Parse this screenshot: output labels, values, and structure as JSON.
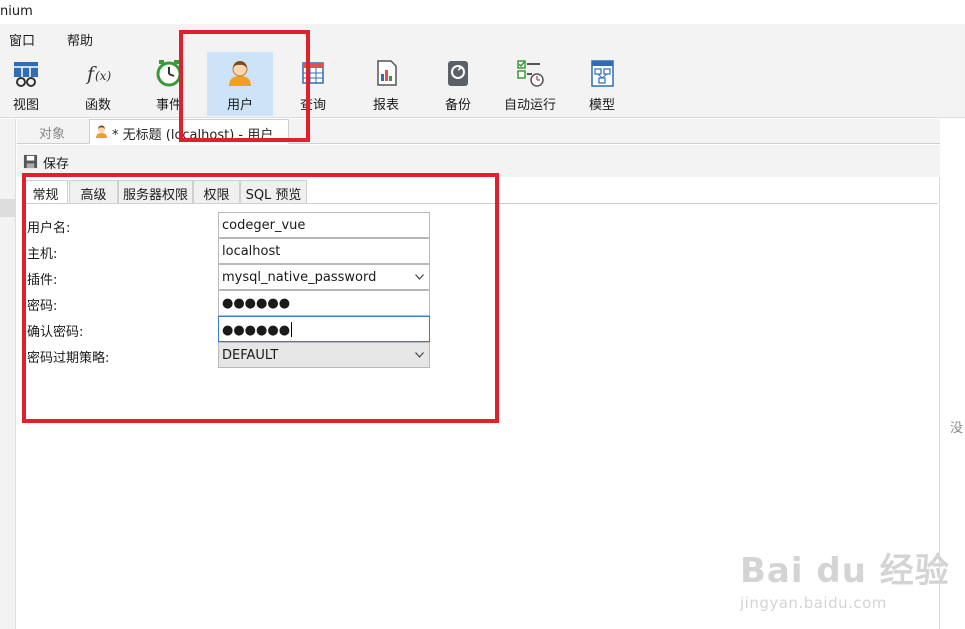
{
  "window": {
    "title": "nium"
  },
  "menu": {
    "items": [
      "窗口",
      "帮助"
    ]
  },
  "toolbar": {
    "tools": [
      {
        "label": "视图",
        "icon": "view-icon"
      },
      {
        "label": "函数",
        "icon": "function-icon"
      },
      {
        "label": "事件",
        "icon": "event-icon"
      },
      {
        "label": "用户",
        "icon": "user-icon",
        "active": true
      },
      {
        "label": "查询",
        "icon": "query-icon"
      },
      {
        "label": "报表",
        "icon": "report-icon"
      },
      {
        "label": "备份",
        "icon": "backup-icon"
      },
      {
        "label": "自动运行",
        "icon": "automation-icon"
      },
      {
        "label": "模型",
        "icon": "model-icon"
      }
    ]
  },
  "tabs": {
    "objects_label": "对象",
    "current_label": "* 无标题 (localhost) - 用户"
  },
  "actions": {
    "save_label": "保存"
  },
  "subtabs": [
    "常规",
    "高级",
    "服务器权限",
    "权限",
    "SQL 预览"
  ],
  "form": {
    "username": {
      "label": "用户名:",
      "value": "codeger_vue"
    },
    "host": {
      "label": "主机:",
      "value": "localhost"
    },
    "plugin": {
      "label": "插件:",
      "value": "mysql_native_password"
    },
    "password": {
      "label": "密码:",
      "value": "●●●●●●"
    },
    "confirm_password": {
      "label": "确认密码:",
      "value": "●●●●●●"
    },
    "expire_policy": {
      "label": "密码过期策略:",
      "value": "DEFAULT"
    }
  },
  "side_text": "没",
  "watermark": {
    "main": "Bai du 经验",
    "url": "jingyan.baidu.com"
  },
  "colors": {
    "highlight": "#e0202a",
    "active_tool": "#cde3f7",
    "focus": "#3b7bd4"
  }
}
